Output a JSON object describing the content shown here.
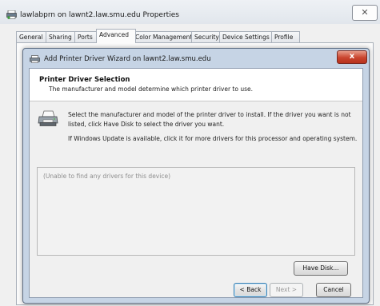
{
  "outer_window": {
    "title": "lawlabprn on lawnt2.law.smu.edu Properties",
    "close_symbol": "✕",
    "tabs": [
      {
        "label": "General"
      },
      {
        "label": "Sharing"
      },
      {
        "label": "Ports"
      },
      {
        "label": "Advanced"
      },
      {
        "label": "Color Management"
      },
      {
        "label": "Security"
      },
      {
        "label": "Device Settings"
      },
      {
        "label": "Profile"
      }
    ],
    "active_tab": "Advanced"
  },
  "wizard": {
    "title": "Add Printer Driver Wizard on lawnt2.law.smu.edu",
    "close_symbol": "x",
    "header": {
      "title": "Printer Driver Selection",
      "subtitle": "The manufacturer and model determine which printer driver to use."
    },
    "instructions": [
      "Select the manufacturer and model of the printer driver to install. If the driver you want is not listed, click Have Disk to select the driver you want.",
      "If Windows Update is available, click it for more drivers for this processor and operating system."
    ],
    "drivers_list_message": "(Unable to find any drivers for this device)",
    "buttons": {
      "have_disk": "Have Disk...",
      "back": "< Back",
      "next": "Next >",
      "cancel": "Cancel"
    }
  },
  "colors": {
    "wizard_frame": "#c6d4e5",
    "close_button_red": "#c9442e",
    "default_button_border": "#3c7fb1"
  },
  "icons": [
    "printer-properties-icon",
    "close-icon",
    "printer-icon"
  ]
}
